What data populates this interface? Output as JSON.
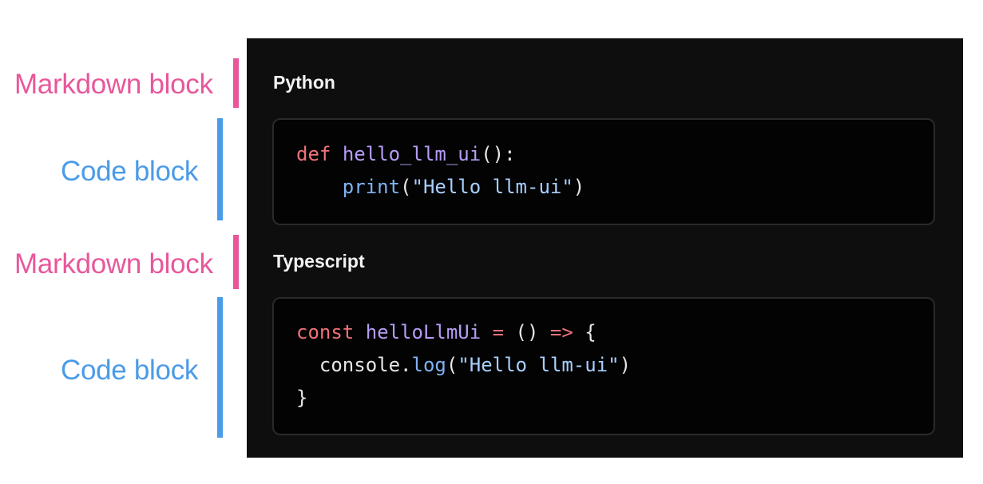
{
  "annotations": [
    {
      "label": "Markdown block",
      "kind": "markdown"
    },
    {
      "label": "Code block",
      "kind": "code"
    },
    {
      "label": "Markdown block",
      "kind": "markdown"
    },
    {
      "label": "Code block",
      "kind": "code"
    }
  ],
  "panel": {
    "blocks": [
      {
        "type": "markdown",
        "text": "Python"
      },
      {
        "type": "code",
        "language": "python",
        "lines": [
          [
            {
              "t": "def",
              "c": "kw"
            },
            {
              "t": " ",
              "c": "punc"
            },
            {
              "t": "hello_llm_ui",
              "c": "fn"
            },
            {
              "t": "():",
              "c": "punc"
            }
          ],
          [
            {
              "t": "    ",
              "c": "punc"
            },
            {
              "t": "print",
              "c": "builtin"
            },
            {
              "t": "(",
              "c": "punc"
            },
            {
              "t": "\"Hello llm-ui\"",
              "c": "str"
            },
            {
              "t": ")",
              "c": "punc"
            }
          ]
        ]
      },
      {
        "type": "markdown",
        "text": "Typescript"
      },
      {
        "type": "code",
        "language": "typescript",
        "lines": [
          [
            {
              "t": "const",
              "c": "kw"
            },
            {
              "t": " ",
              "c": "punc"
            },
            {
              "t": "helloLlmUi",
              "c": "fn"
            },
            {
              "t": " ",
              "c": "punc"
            },
            {
              "t": "=",
              "c": "op"
            },
            {
              "t": " () ",
              "c": "punc"
            },
            {
              "t": "=>",
              "c": "op"
            },
            {
              "t": " {",
              "c": "punc"
            }
          ],
          [
            {
              "t": "  console.",
              "c": "punc"
            },
            {
              "t": "log",
              "c": "builtin"
            },
            {
              "t": "(",
              "c": "punc"
            },
            {
              "t": "\"Hello llm-ui\"",
              "c": "str"
            },
            {
              "t": ")",
              "c": "punc"
            }
          ],
          [
            {
              "t": "}",
              "c": "punc"
            }
          ]
        ]
      }
    ]
  },
  "colors": {
    "markdown_accent": "#e8579b",
    "code_accent": "#4a9be8",
    "panel_bg": "#0e0e0e",
    "code_bg": "#030303"
  }
}
